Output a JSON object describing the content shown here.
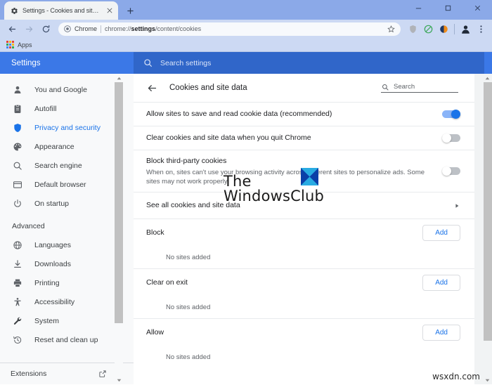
{
  "browser": {
    "tab": {
      "title": "Settings - Cookies and site data",
      "favicon": "gear-icon",
      "close": "×"
    },
    "new_tab_label": "+",
    "window_controls": {
      "minimize": "–",
      "maximize": "□",
      "close": "×"
    },
    "nav": {
      "back": "←",
      "forward": "→",
      "reload": "⟳"
    },
    "omnibox": {
      "chip": "Chrome",
      "url_prefix": "chrome://",
      "url_bold": "settings",
      "url_suffix": "/content/cookies",
      "star": "☆"
    },
    "extensions": [
      {
        "name": "shield-extension-icon",
        "color": "#b0b3b8"
      },
      {
        "name": "adblock-extension-icon",
        "color": "#3aa757"
      },
      {
        "name": "orange-extension-icon",
        "color": "#f08c1a"
      }
    ],
    "profile_icon": "avatar-icon",
    "menu_icon": "three-dot-menu-icon",
    "bookmarks": [
      {
        "label": "Apps",
        "icon": "apps-grid-icon"
      }
    ]
  },
  "settings": {
    "title": "Settings",
    "search": {
      "placeholder": "Search settings",
      "icon": "search-icon"
    },
    "sidebar": {
      "items": [
        {
          "label": "You and Google",
          "icon": "person-icon",
          "active": false
        },
        {
          "label": "Autofill",
          "icon": "clipboard-icon",
          "active": false
        },
        {
          "label": "Privacy and security",
          "icon": "shield-icon",
          "active": true
        },
        {
          "label": "Appearance",
          "icon": "palette-icon",
          "active": false
        },
        {
          "label": "Search engine",
          "icon": "magnifier-icon",
          "active": false
        },
        {
          "label": "Default browser",
          "icon": "browser-window-icon",
          "active": false
        },
        {
          "label": "On startup",
          "icon": "power-icon",
          "active": false
        }
      ],
      "advanced": {
        "label": "Advanced",
        "caret": "collapse-caret-icon",
        "items": [
          {
            "label": "Languages",
            "icon": "globe-icon"
          },
          {
            "label": "Downloads",
            "icon": "download-icon"
          },
          {
            "label": "Printing",
            "icon": "printer-icon"
          },
          {
            "label": "Accessibility",
            "icon": "accessibility-icon"
          },
          {
            "label": "System",
            "icon": "wrench-icon"
          },
          {
            "label": "Reset and clean up",
            "icon": "history-restore-icon"
          }
        ]
      },
      "footer": {
        "label": "Extensions",
        "icon": "external-link-icon"
      }
    }
  },
  "main": {
    "back_icon": "back-arrow-icon",
    "title": "Cookies and site data",
    "inline_search": {
      "placeholder": "Search",
      "icon": "search-icon"
    },
    "settings_rows": [
      {
        "title": "Allow sites to save and read cookie data (recommended)",
        "sub": "",
        "toggle": "on"
      },
      {
        "title": "Clear cookies and site data when you quit Chrome",
        "sub": "",
        "toggle": "off"
      },
      {
        "title": "Block third-party cookies",
        "sub": "When on, sites can't use your browsing activity across different sites to personalize ads. Some sites may not work properly.",
        "toggle": "off"
      }
    ],
    "see_all": {
      "label": "See all cookies and site data",
      "chevron": "›"
    },
    "site_sections": [
      {
        "label": "Block",
        "add_label": "Add",
        "empty": "No sites added"
      },
      {
        "label": "Clear on exit",
        "add_label": "Add",
        "empty": "No sites added"
      },
      {
        "label": "Allow",
        "add_label": "Add",
        "empty": "No sites added"
      }
    ]
  },
  "watermarks": {
    "main_line1": "The",
    "main_line2": "WindowsClub",
    "logo": "windowsclub-logo",
    "corner": "wsxdn.com"
  },
  "colors": {
    "accent": "#1a73e8",
    "settings_bar": "#3b78e7",
    "settings_search_bg": "#3066c9",
    "tabstrip": "#8ba9e8",
    "toolbar": "#ccd9f3",
    "page_bg": "#f1f3f4",
    "sidebar_bg": "#f8f9fa"
  }
}
